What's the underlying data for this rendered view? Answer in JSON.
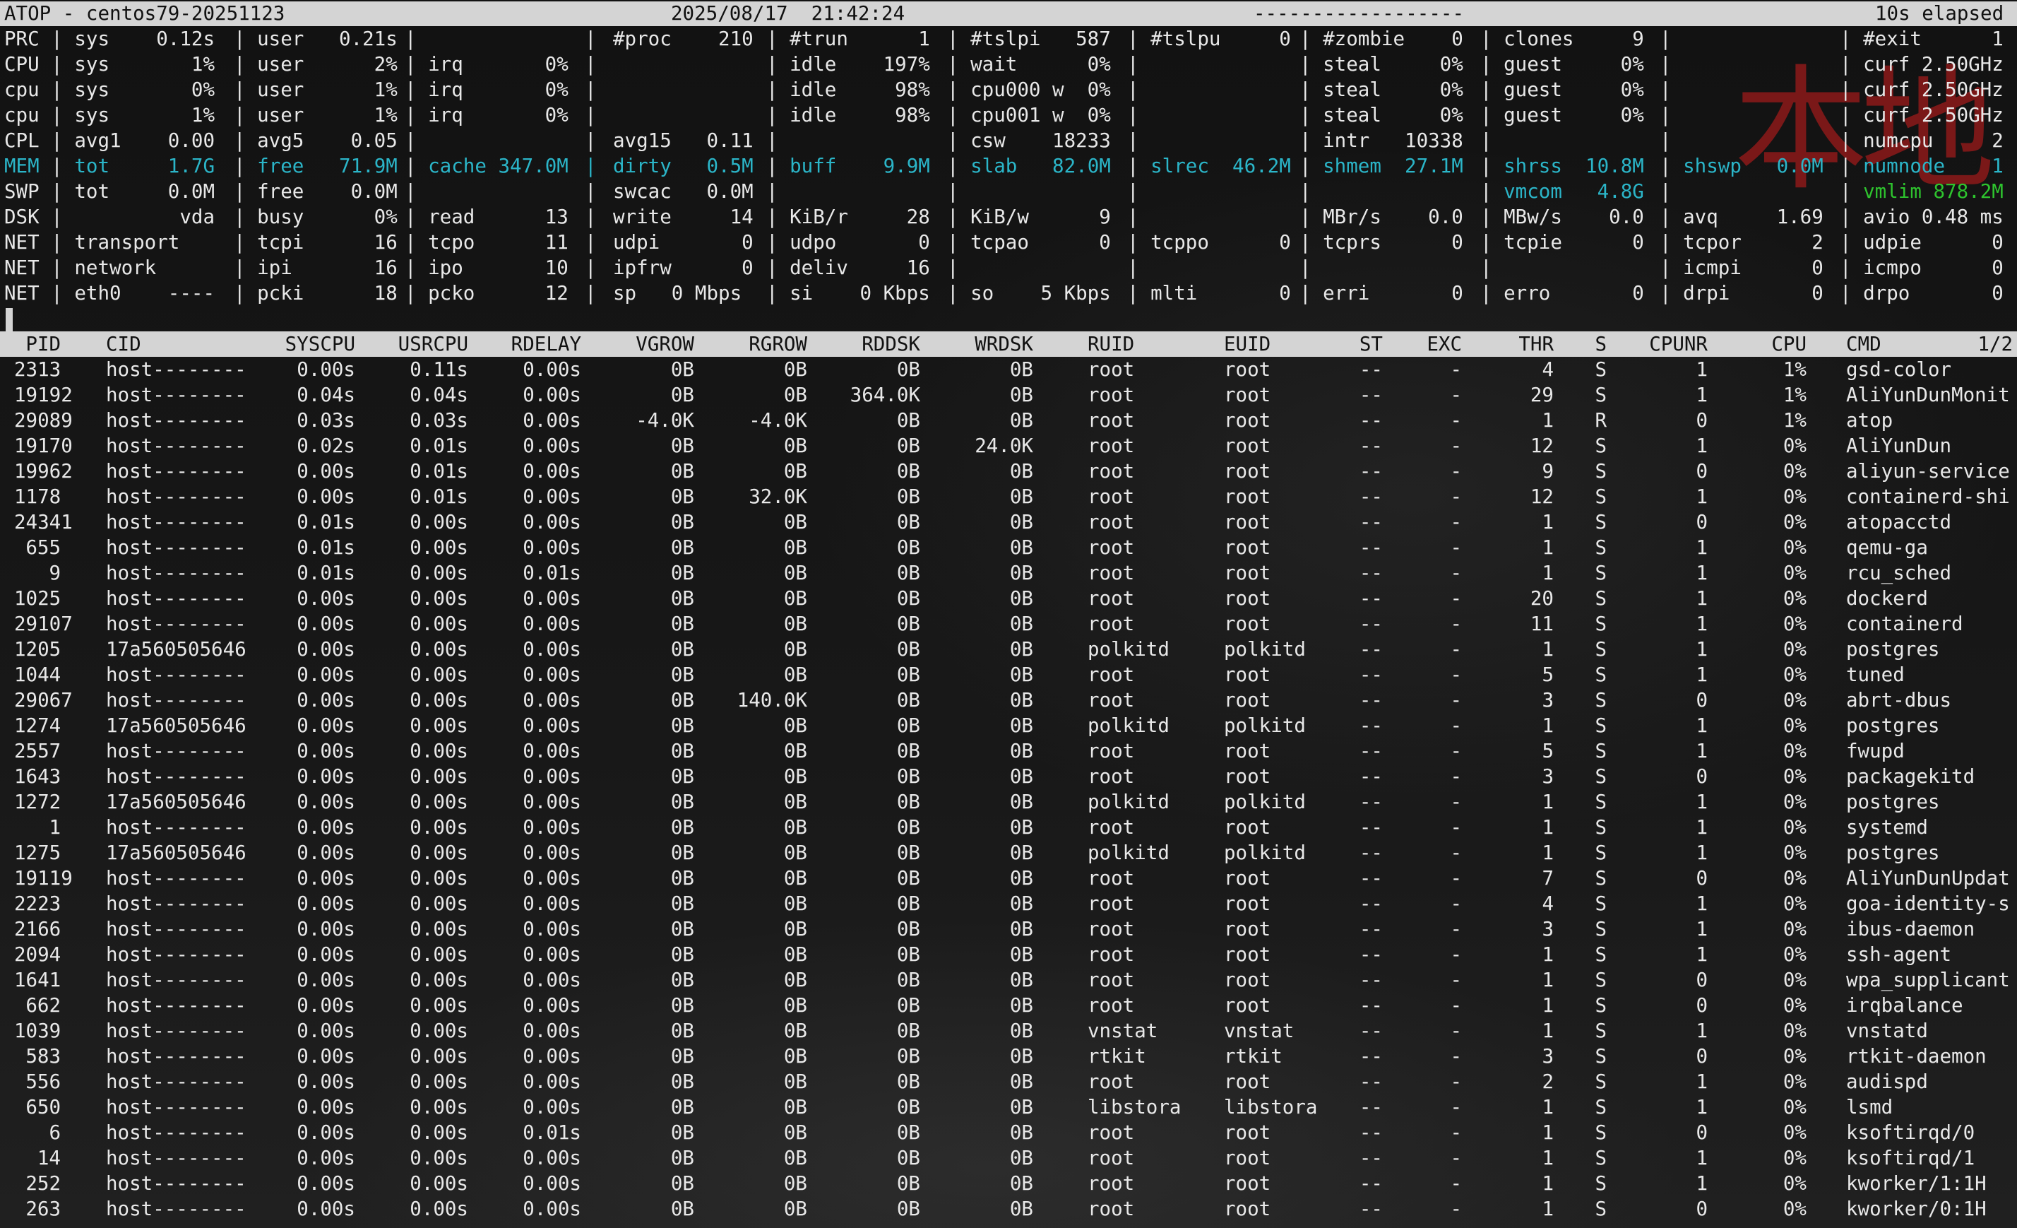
{
  "title_bar": {
    "app": "ATOP - centos79-20251123",
    "datetime": "2025/08/17  21:42:24",
    "dashes": "------------------",
    "elapsed": "10s elapsed"
  },
  "system_rows": [
    [
      "PRC | sys    0.12s",
      "| user   0.21s",
      "|",
      "|",
      "#proc    210",
      "| #trun      1",
      "| #tslpi   587",
      "| #tslpu     0",
      "| #zombie    0",
      "| clones     9",
      "|",
      "| #exit      1"
    ],
    [
      "CPU | sys       1%",
      "| user      2%",
      "| irq       0%",
      "|",
      "",
      "| idle    197%",
      "| wait      0%",
      "|",
      "| steal     0%",
      "| guest     0%",
      "|",
      "| curf 2.50GHz"
    ],
    [
      "cpu | sys       0%",
      "| user      1%",
      "| irq       0%",
      "|",
      "",
      "| idle     98%",
      "| cpu000 w  0%",
      "|",
      "| steal     0%",
      "| guest     0%",
      "|",
      "| curf 2.50GHz"
    ],
    [
      "cpu | sys       1%",
      "| user      1%",
      "| irq       0%",
      "|",
      "",
      "| idle     98%",
      "| cpu001 w  0%",
      "|",
      "| steal     0%",
      "| guest     0%",
      "|",
      "| curf 2.50GHz"
    ],
    [
      "CPL | avg1    0.00",
      "| avg5    0.05",
      "|",
      "|",
      "avg15   0.11",
      "|",
      "| csw    18233",
      "|",
      "| intr   10338",
      "|",
      "|",
      "| numcpu     2"
    ],
    [
      "MEM | tot     1.7G",
      "| free   71.9M",
      "| cache 347.0M",
      "|",
      "dirty   0.5M",
      "| buff    9.9M",
      "| slab   82.0M",
      "| slrec  46.2M",
      "| shmem  27.1M",
      "| shrss  10.8M",
      "| shswp   0.0M",
      "| numnode    1"
    ],
    [
      "SWP | tot     0.0M",
      "| free    0.0M",
      "|",
      "|",
      "swcac   0.0M",
      "|",
      "|",
      "|",
      "|",
      "| vmcom   4.8G",
      "|",
      "| vmlim 878.2M"
    ],
    [
      "DSK |          vda",
      "| busy      0%",
      "| read      13",
      "|",
      "write     14",
      "| KiB/r     28",
      "| KiB/w      9",
      "|",
      "| MBr/s    0.0",
      "| MBw/s    0.0",
      "| avq     1.69",
      "| avio 0.48 ms"
    ],
    [
      "NET | transport",
      "| tcpi      16",
      "| tcpo      11",
      "|",
      "udpi       0",
      "| udpo       0",
      "| tcpao      0",
      "| tcppo      0",
      "| tcprs      0",
      "| tcpie      0",
      "| tcpor      2",
      "| udpie      0"
    ],
    [
      "NET | network",
      "| ipi       16",
      "| ipo       10",
      "|",
      "ipfrw      0",
      "| deliv     16",
      "|",
      "|",
      "|",
      "|",
      "| icmpi      0",
      "| icmpo      0"
    ],
    [
      "NET | eth0    ----",
      "| pcki      18",
      "| pcko      12",
      "|",
      "sp   0 Mbps",
      "| si    0 Kbps",
      "| so    5 Kbps",
      "| mlti       0",
      "| erri       0",
      "| erro       0",
      "| drpi       0",
      "| drpo       0"
    ]
  ],
  "system_colors": {
    "cyan": "#2bb5c8",
    "green": "#2ec42e",
    "watermark": "#7a1818"
  },
  "watermark_text": "本地",
  "process_header": {
    "pid": "PID",
    "cid": "CID",
    "syscpu": "SYSCPU",
    "usrcpu": "USRCPU",
    "rdelay": "RDELAY",
    "vgrow": "VGROW",
    "rgrow": "RGROW",
    "rddsk": "RDDSK",
    "wrdsk": "WRDSK",
    "ruid": "RUID",
    "euid": "EUID",
    "st": "ST",
    "exc": "EXC",
    "thr": "THR",
    "s": "S",
    "cpunr": "CPUNR",
    "cpu": "CPU",
    "cmd": "CMD",
    "page": "1/2"
  },
  "processes": [
    [
      "2313",
      "host--------",
      "0.00s",
      "0.11s",
      "0.00s",
      "0B",
      "0B",
      "0B",
      "0B",
      "root",
      "root",
      "--",
      "-",
      "4",
      "S",
      "1",
      "1%",
      "gsd-color"
    ],
    [
      "19192",
      "host--------",
      "0.04s",
      "0.04s",
      "0.00s",
      "0B",
      "0B",
      "364.0K",
      "0B",
      "root",
      "root",
      "--",
      "-",
      "29",
      "S",
      "1",
      "1%",
      "AliYunDunMonit"
    ],
    [
      "29089",
      "host--------",
      "0.03s",
      "0.03s",
      "0.00s",
      "-4.0K",
      "-4.0K",
      "0B",
      "0B",
      "root",
      "root",
      "--",
      "-",
      "1",
      "R",
      "0",
      "1%",
      "atop"
    ],
    [
      "19170",
      "host--------",
      "0.02s",
      "0.01s",
      "0.00s",
      "0B",
      "0B",
      "0B",
      "24.0K",
      "root",
      "root",
      "--",
      "-",
      "12",
      "S",
      "1",
      "0%",
      "AliYunDun"
    ],
    [
      "19962",
      "host--------",
      "0.00s",
      "0.01s",
      "0.00s",
      "0B",
      "0B",
      "0B",
      "0B",
      "root",
      "root",
      "--",
      "-",
      "9",
      "S",
      "0",
      "0%",
      "aliyun-service"
    ],
    [
      "1178",
      "host--------",
      "0.00s",
      "0.01s",
      "0.00s",
      "0B",
      "32.0K",
      "0B",
      "0B",
      "root",
      "root",
      "--",
      "-",
      "12",
      "S",
      "1",
      "0%",
      "containerd-shi"
    ],
    [
      "24341",
      "host--------",
      "0.01s",
      "0.00s",
      "0.00s",
      "0B",
      "0B",
      "0B",
      "0B",
      "root",
      "root",
      "--",
      "-",
      "1",
      "S",
      "0",
      "0%",
      "atopacctd"
    ],
    [
      "655",
      "host--------",
      "0.01s",
      "0.00s",
      "0.00s",
      "0B",
      "0B",
      "0B",
      "0B",
      "root",
      "root",
      "--",
      "-",
      "1",
      "S",
      "1",
      "0%",
      "qemu-ga"
    ],
    [
      "9",
      "host--------",
      "0.01s",
      "0.00s",
      "0.01s",
      "0B",
      "0B",
      "0B",
      "0B",
      "root",
      "root",
      "--",
      "-",
      "1",
      "S",
      "1",
      "0%",
      "rcu_sched"
    ],
    [
      "1025",
      "host--------",
      "0.00s",
      "0.00s",
      "0.00s",
      "0B",
      "0B",
      "0B",
      "0B",
      "root",
      "root",
      "--",
      "-",
      "20",
      "S",
      "1",
      "0%",
      "dockerd"
    ],
    [
      "29107",
      "host--------",
      "0.00s",
      "0.00s",
      "0.00s",
      "0B",
      "0B",
      "0B",
      "0B",
      "root",
      "root",
      "--",
      "-",
      "11",
      "S",
      "1",
      "0%",
      "containerd"
    ],
    [
      "1205",
      "17a560505646",
      "0.00s",
      "0.00s",
      "0.00s",
      "0B",
      "0B",
      "0B",
      "0B",
      "polkitd",
      "polkitd",
      "--",
      "-",
      "1",
      "S",
      "1",
      "0%",
      "postgres"
    ],
    [
      "1044",
      "host--------",
      "0.00s",
      "0.00s",
      "0.00s",
      "0B",
      "0B",
      "0B",
      "0B",
      "root",
      "root",
      "--",
      "-",
      "5",
      "S",
      "1",
      "0%",
      "tuned"
    ],
    [
      "29067",
      "host--------",
      "0.00s",
      "0.00s",
      "0.00s",
      "0B",
      "140.0K",
      "0B",
      "0B",
      "root",
      "root",
      "--",
      "-",
      "3",
      "S",
      "0",
      "0%",
      "abrt-dbus"
    ],
    [
      "1274",
      "17a560505646",
      "0.00s",
      "0.00s",
      "0.00s",
      "0B",
      "0B",
      "0B",
      "0B",
      "polkitd",
      "polkitd",
      "--",
      "-",
      "1",
      "S",
      "1",
      "0%",
      "postgres"
    ],
    [
      "2557",
      "host--------",
      "0.00s",
      "0.00s",
      "0.00s",
      "0B",
      "0B",
      "0B",
      "0B",
      "root",
      "root",
      "--",
      "-",
      "5",
      "S",
      "1",
      "0%",
      "fwupd"
    ],
    [
      "1643",
      "host--------",
      "0.00s",
      "0.00s",
      "0.00s",
      "0B",
      "0B",
      "0B",
      "0B",
      "root",
      "root",
      "--",
      "-",
      "3",
      "S",
      "0",
      "0%",
      "packagekitd"
    ],
    [
      "1272",
      "17a560505646",
      "0.00s",
      "0.00s",
      "0.00s",
      "0B",
      "0B",
      "0B",
      "0B",
      "polkitd",
      "polkitd",
      "--",
      "-",
      "1",
      "S",
      "1",
      "0%",
      "postgres"
    ],
    [
      "1",
      "host--------",
      "0.00s",
      "0.00s",
      "0.00s",
      "0B",
      "0B",
      "0B",
      "0B",
      "root",
      "root",
      "--",
      "-",
      "1",
      "S",
      "1",
      "0%",
      "systemd"
    ],
    [
      "1275",
      "17a560505646",
      "0.00s",
      "0.00s",
      "0.00s",
      "0B",
      "0B",
      "0B",
      "0B",
      "polkitd",
      "polkitd",
      "--",
      "-",
      "1",
      "S",
      "1",
      "0%",
      "postgres"
    ],
    [
      "19119",
      "host--------",
      "0.00s",
      "0.00s",
      "0.00s",
      "0B",
      "0B",
      "0B",
      "0B",
      "root",
      "root",
      "--",
      "-",
      "7",
      "S",
      "0",
      "0%",
      "AliYunDunUpdat"
    ],
    [
      "2223",
      "host--------",
      "0.00s",
      "0.00s",
      "0.00s",
      "0B",
      "0B",
      "0B",
      "0B",
      "root",
      "root",
      "--",
      "-",
      "4",
      "S",
      "1",
      "0%",
      "goa-identity-s"
    ],
    [
      "2166",
      "host--------",
      "0.00s",
      "0.00s",
      "0.00s",
      "0B",
      "0B",
      "0B",
      "0B",
      "root",
      "root",
      "--",
      "-",
      "3",
      "S",
      "1",
      "0%",
      "ibus-daemon"
    ],
    [
      "2094",
      "host--------",
      "0.00s",
      "0.00s",
      "0.00s",
      "0B",
      "0B",
      "0B",
      "0B",
      "root",
      "root",
      "--",
      "-",
      "1",
      "S",
      "1",
      "0%",
      "ssh-agent"
    ],
    [
      "1641",
      "host--------",
      "0.00s",
      "0.00s",
      "0.00s",
      "0B",
      "0B",
      "0B",
      "0B",
      "root",
      "root",
      "--",
      "-",
      "1",
      "S",
      "0",
      "0%",
      "wpa_supplicant"
    ],
    [
      "662",
      "host--------",
      "0.00s",
      "0.00s",
      "0.00s",
      "0B",
      "0B",
      "0B",
      "0B",
      "root",
      "root",
      "--",
      "-",
      "1",
      "S",
      "0",
      "0%",
      "irqbalance"
    ],
    [
      "1039",
      "host--------",
      "0.00s",
      "0.00s",
      "0.00s",
      "0B",
      "0B",
      "0B",
      "0B",
      "vnstat",
      "vnstat",
      "--",
      "-",
      "1",
      "S",
      "1",
      "0%",
      "vnstatd"
    ],
    [
      "583",
      "host--------",
      "0.00s",
      "0.00s",
      "0.00s",
      "0B",
      "0B",
      "0B",
      "0B",
      "rtkit",
      "rtkit",
      "--",
      "-",
      "3",
      "S",
      "0",
      "0%",
      "rtkit-daemon"
    ],
    [
      "556",
      "host--------",
      "0.00s",
      "0.00s",
      "0.00s",
      "0B",
      "0B",
      "0B",
      "0B",
      "root",
      "root",
      "--",
      "-",
      "2",
      "S",
      "1",
      "0%",
      "audispd"
    ],
    [
      "650",
      "host--------",
      "0.00s",
      "0.00s",
      "0.00s",
      "0B",
      "0B",
      "0B",
      "0B",
      "libstora",
      "libstora",
      "--",
      "-",
      "1",
      "S",
      "1",
      "0%",
      "lsmd"
    ],
    [
      "6",
      "host--------",
      "0.00s",
      "0.00s",
      "0.01s",
      "0B",
      "0B",
      "0B",
      "0B",
      "root",
      "root",
      "--",
      "-",
      "1",
      "S",
      "0",
      "0%",
      "ksoftirqd/0"
    ],
    [
      "14",
      "host--------",
      "0.00s",
      "0.00s",
      "0.00s",
      "0B",
      "0B",
      "0B",
      "0B",
      "root",
      "root",
      "--",
      "-",
      "1",
      "S",
      "1",
      "0%",
      "ksoftirqd/1"
    ],
    [
      "252",
      "host--------",
      "0.00s",
      "0.00s",
      "0.00s",
      "0B",
      "0B",
      "0B",
      "0B",
      "root",
      "root",
      "--",
      "-",
      "1",
      "S",
      "1",
      "0%",
      "kworker/1:1H"
    ],
    [
      "263",
      "host--------",
      "0.00s",
      "0.00s",
      "0.00s",
      "0B",
      "0B",
      "0B",
      "0B",
      "root",
      "root",
      "--",
      "-",
      "1",
      "S",
      "0",
      "0%",
      "kworker/0:1H"
    ]
  ]
}
